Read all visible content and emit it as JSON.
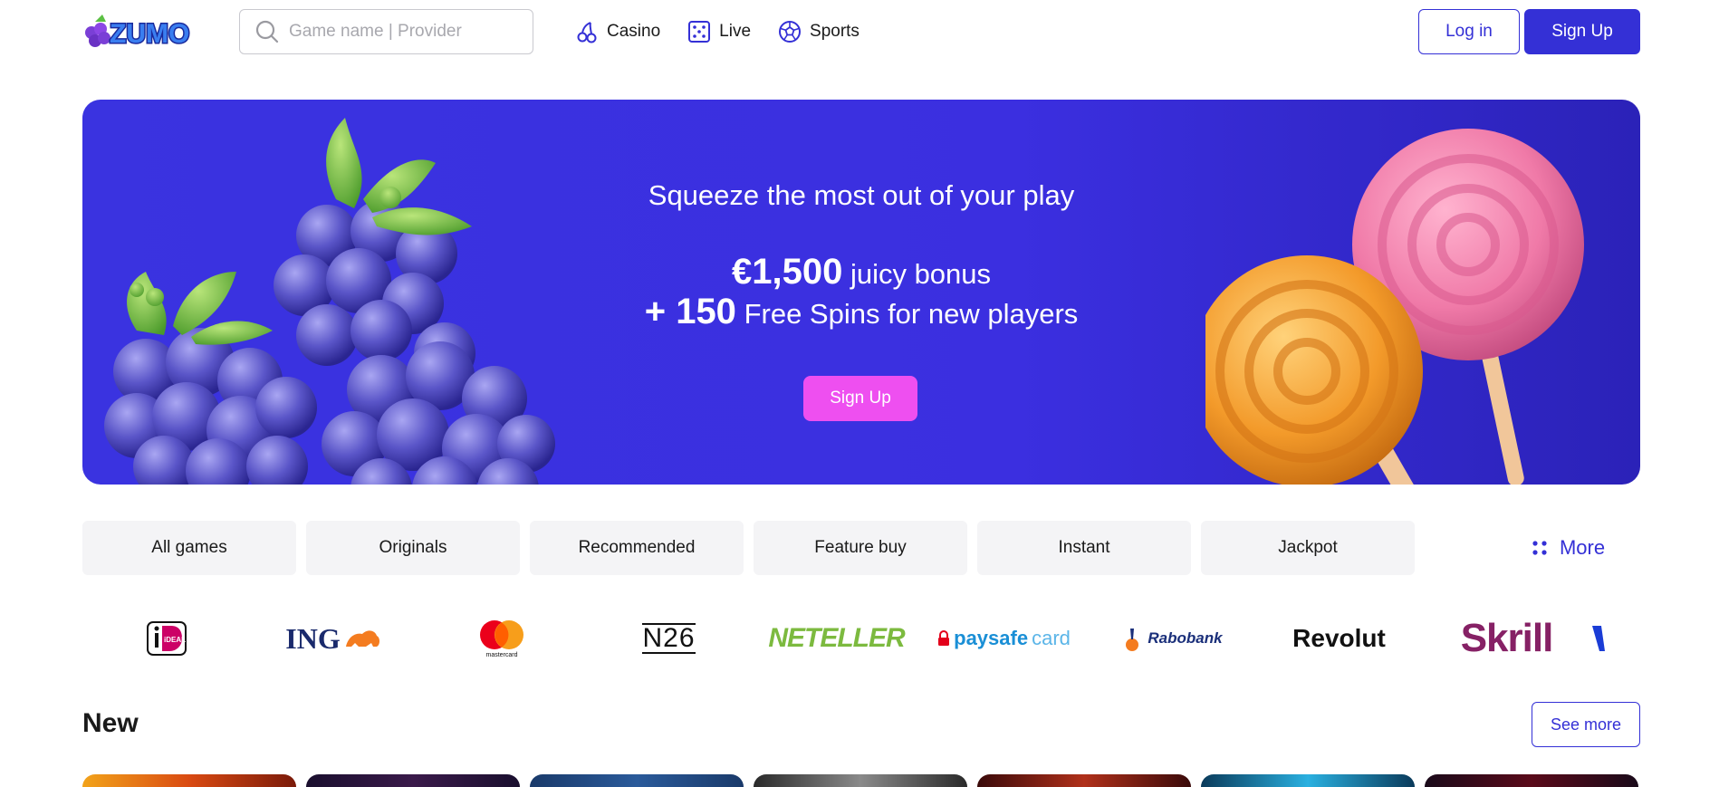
{
  "header": {
    "logo_text": "ZUMO",
    "search_placeholder": "Game name | Provider",
    "nav": [
      {
        "label": "Casino",
        "icon": "cherry-icon"
      },
      {
        "label": "Live",
        "icon": "dice-icon"
      },
      {
        "label": "Sports",
        "icon": "soccer-ball-icon"
      }
    ],
    "login_label": "Log in",
    "signup_label": "Sign Up"
  },
  "hero": {
    "title": "Squeeze the most out of your play",
    "line1_amount": "€1,500",
    "line1_text": "juicy bonus",
    "line2_amount": "+ 150",
    "line2_text": "Free Spins for new players",
    "cta_label": "Sign Up"
  },
  "tabs": [
    "All games",
    "Originals",
    "Recommended",
    "Feature buy",
    "Instant",
    "Jackpot"
  ],
  "more_label": "More",
  "payments": {
    "ideal": "iDEAL",
    "ing": "ING",
    "mastercard": "mastercard",
    "n26": "N26",
    "neteller": "NETELLER",
    "paysafe_a": "paysafe",
    "paysafe_b": "card",
    "rabobank": "Rabobank",
    "revolut": "Revolut",
    "skrill": "Skrill"
  },
  "section": {
    "title": "New",
    "see_more_label": "See more"
  },
  "colors": {
    "brand": "#3430d6",
    "hero_bg": "#3a33e0",
    "cta_pink": "#ee4ff0",
    "tab_bg": "#f4f4f6"
  }
}
